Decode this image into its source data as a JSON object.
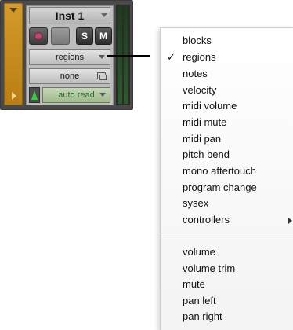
{
  "track": {
    "name": "Inst 1",
    "solo_label": "S",
    "mute_label": "M",
    "view_selector": "regions",
    "playlist_selector": "none",
    "automation_mode": "auto read"
  },
  "menu": {
    "checked": "regions",
    "group1": [
      "blocks",
      "regions",
      "notes",
      "velocity",
      "midi volume",
      "midi mute",
      "midi pan",
      "pitch bend",
      "mono aftertouch",
      "program change",
      "sysex",
      "controllers"
    ],
    "group2": [
      "volume",
      "volume trim",
      "mute",
      "pan left",
      "pan right"
    ]
  },
  "colors": {
    "track_color": "#c98c1e",
    "automation_text": "#2f6b2a",
    "record_dot": "#c04a6a"
  }
}
